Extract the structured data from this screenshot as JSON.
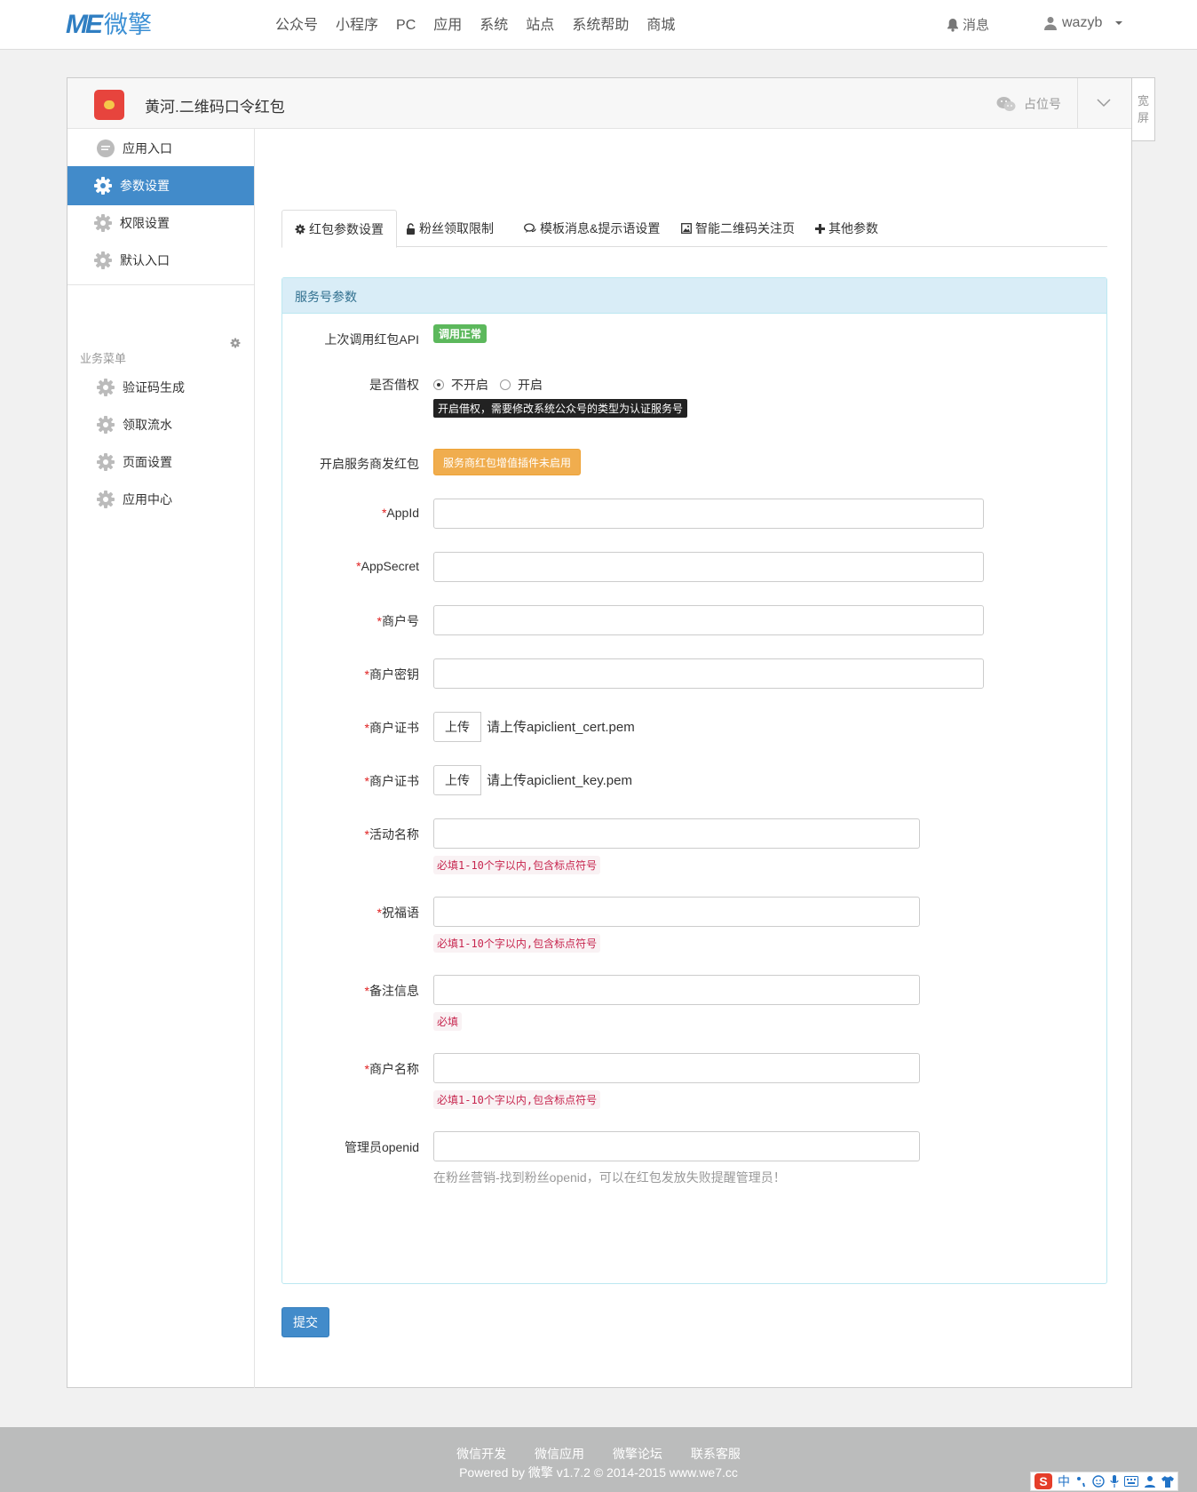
{
  "header": {
    "logo_mark": "ME",
    "logo_text": "微擎",
    "nav": [
      "公众号",
      "小程序",
      "PC",
      "应用",
      "系统",
      "站点",
      "系统帮助",
      "商城"
    ],
    "messages": "消息",
    "username": "wazyb"
  },
  "app": {
    "title": "黄河.二维码口令红包",
    "account_placeholder": "占位号",
    "wide_label": "宽屏"
  },
  "sidebar": {
    "items": [
      "应用入口",
      "参数设置",
      "权限设置",
      "默认入口"
    ],
    "section_title": "业务菜单",
    "business_items": [
      "验证码生成",
      "领取流水",
      "页面设置",
      "应用中心"
    ]
  },
  "tabs": [
    "红包参数设置",
    "粉丝领取限制",
    "模板消息&提示语设置",
    "智能二维码关注页",
    "其他参数"
  ],
  "panel": {
    "title": "服务号参数",
    "api_label": "上次调用红包API",
    "api_status": "调用正常",
    "borrow_label": "是否借权",
    "borrow_options": [
      "不开启",
      "开启"
    ],
    "borrow_tip": "开启借权，需要修改系统公众号的类型为认证服务号",
    "provider_label": "开启服务商发红包",
    "provider_button": "服务商红包增值插件未启用",
    "appid_label": "AppId",
    "appsecret_label": "AppSecret",
    "mchid_label": "商户号",
    "mchkey_label": "商户密钥",
    "cert_label": "商户证书",
    "upload_label": "上传",
    "cert_hint": "请上传apiclient_cert.pem",
    "key_label": "商户证书",
    "key_hint": "请上传apiclient_key.pem",
    "activity_label": "活动名称",
    "activity_hint": "必填1-10个字以内,包含标点符号",
    "wish_label": "祝福语",
    "wish_hint": "必填1-10个字以内,包含标点符号",
    "remark_label": "备注信息",
    "remark_hint": "必填",
    "merchant_label": "商户名称",
    "merchant_hint": "必填1-10个字以内,包含标点符号",
    "admin_label": "管理员openid",
    "admin_help": "在粉丝营销-找到粉丝openid，可以在红包发放失败提醒管理员！",
    "required_mark": "*"
  },
  "submit_label": "提交",
  "footer": {
    "links": [
      "微信开发",
      "微信应用",
      "微擎论坛",
      "联系客服"
    ],
    "copyright": "Powered by 微擎 v1.7.2 © 2014-2015 www.we7.cc"
  },
  "ime": {
    "logo": "S",
    "mode": "中"
  },
  "colors": {
    "primary": "#428bca",
    "success": "#5cb85c",
    "warning": "#f0ad4e",
    "panel_header": "#d9edf7"
  }
}
